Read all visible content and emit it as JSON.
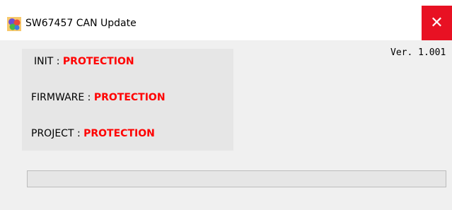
{
  "window": {
    "title": "SW67457 CAN Update",
    "close_symbol": "✕",
    "icon": "app-icon"
  },
  "version": "Ver. 1.001",
  "status": {
    "init_label": "INIT : ",
    "init_value": "PROTECTION",
    "firmware_label": "FIRMWARE : ",
    "firmware_value": "PROTECTION",
    "project_label": "PROJECT : ",
    "project_value": "PROTECTION"
  },
  "progress": {
    "fraction": 0
  },
  "colors": {
    "status_value": "#ff0000",
    "title_bar": "#ffffff",
    "close_button": "#e81123",
    "client_background": "#f0f0f0"
  }
}
